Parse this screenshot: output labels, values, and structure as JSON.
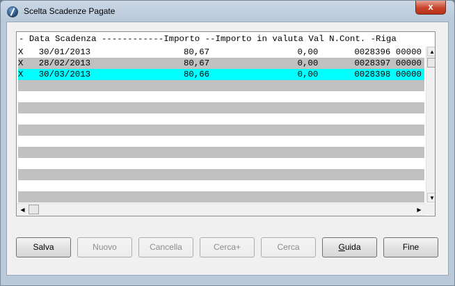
{
  "window": {
    "title": "Scelta Scadenze Pagate",
    "close_label": "x"
  },
  "grid": {
    "header": "- Data Scadenza ------------Importo --Importo in valuta Val N.Cont. -Riga",
    "rows": [
      {
        "text": "X   30/01/2013                  80,67                 0,00       0028396 00000",
        "style": ""
      },
      {
        "text": "X   28/02/2013                  80,67                 0,00       0028397 00000",
        "style": "grey"
      },
      {
        "text": "X   30/03/2013                  80,66                 0,00       0028398 00000",
        "style": "cyan"
      },
      {
        "text": "",
        "style": "grey"
      },
      {
        "text": "",
        "style": ""
      },
      {
        "text": "",
        "style": "grey"
      },
      {
        "text": "",
        "style": ""
      },
      {
        "text": "",
        "style": "grey"
      },
      {
        "text": "",
        "style": ""
      },
      {
        "text": "",
        "style": "grey"
      },
      {
        "text": "",
        "style": ""
      },
      {
        "text": "",
        "style": "grey"
      },
      {
        "text": "",
        "style": ""
      },
      {
        "text": "",
        "style": "grey"
      }
    ]
  },
  "buttons": {
    "salva": "Salva",
    "nuovo": "Nuovo",
    "cancella": "Cancella",
    "cerca_plus": "Cerca+",
    "cerca": "Cerca",
    "guida_first": "G",
    "guida_rest": "uida",
    "fine": "Fine"
  },
  "icons": {
    "scroll_up": "up-arrow-icon",
    "scroll_down": "down-arrow-icon",
    "scroll_left": "left-arrow-icon",
    "scroll_right": "right-arrow-icon"
  }
}
